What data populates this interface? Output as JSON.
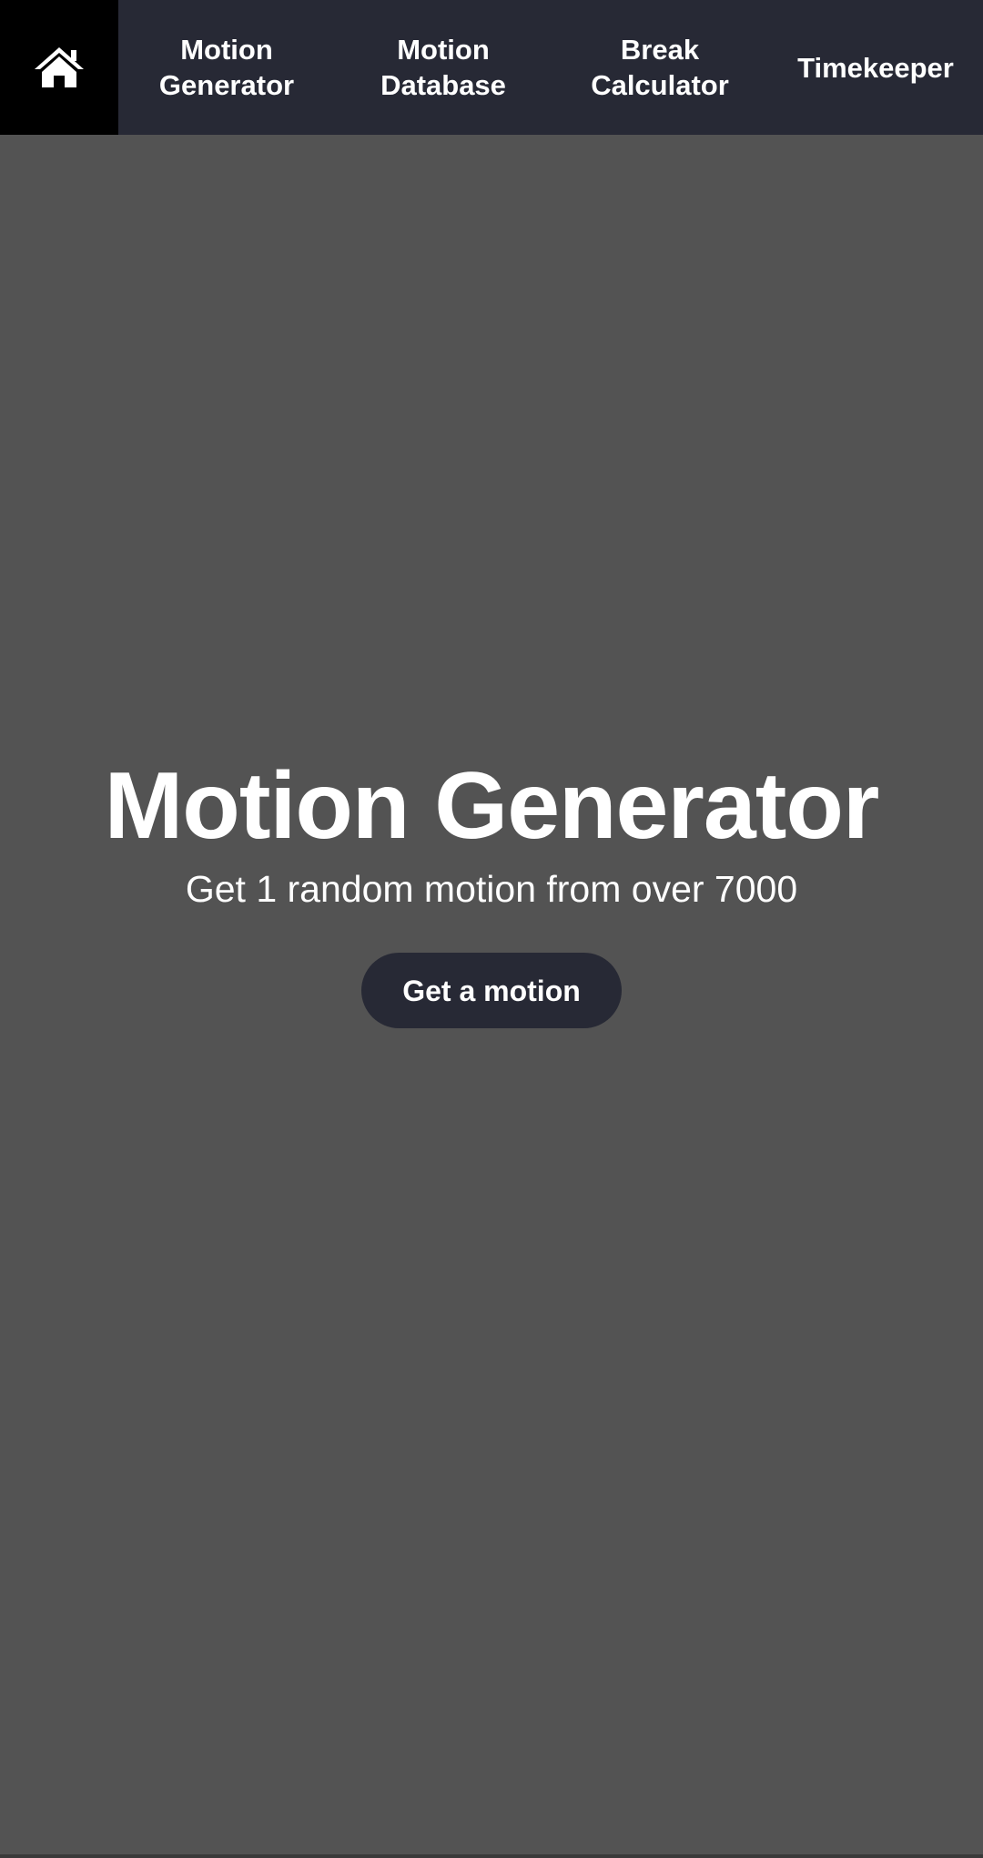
{
  "nav": {
    "home_icon": "home-icon",
    "items": [
      {
        "label": "Motion\nGenerator"
      },
      {
        "label": "Motion\nDatabase"
      },
      {
        "label": "Break\nCalculator"
      },
      {
        "label": "Timekeeper"
      }
    ]
  },
  "hero": {
    "title": "Motion Generator",
    "subtitle": "Get 1 random motion from over 7000",
    "button_label": "Get a motion"
  },
  "colors": {
    "nav_bg": "#272935",
    "home_bg": "#000000",
    "page_bg": "#535353",
    "text": "#ffffff"
  }
}
